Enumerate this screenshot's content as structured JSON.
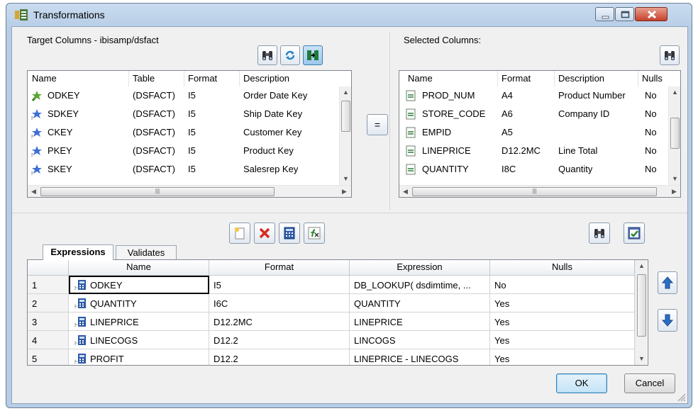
{
  "window": {
    "title": "Transformations"
  },
  "target": {
    "label": "Target Columns - ibisamp/dsfact",
    "headers": [
      "Name",
      "Table",
      "Format",
      "Description"
    ],
    "rows": [
      {
        "name": "ODKEY",
        "table": "(DSFACT)",
        "format": "I5",
        "description": "Order Date Key",
        "icon": "key-green-icon"
      },
      {
        "name": "SDKEY",
        "table": "(DSFACT)",
        "format": "I5",
        "description": "Ship Date Key",
        "icon": "key-blue-icon"
      },
      {
        "name": "CKEY",
        "table": "(DSFACT)",
        "format": "I5",
        "description": "Customer Key",
        "icon": "key-blue-icon"
      },
      {
        "name": "PKEY",
        "table": "(DSFACT)",
        "format": "I5",
        "description": "Product Key",
        "icon": "key-blue-icon"
      },
      {
        "name": "SKEY",
        "table": "(DSFACT)",
        "format": "I5",
        "description": "Salesrep Key",
        "icon": "key-blue-icon"
      }
    ]
  },
  "selected": {
    "label": "Selected Columns:",
    "headers": [
      "Name",
      "Format",
      "Description",
      "Nulls"
    ],
    "rows": [
      {
        "name": "PROD_NUM",
        "format": "A4",
        "description": "Product Number",
        "nulls": "No"
      },
      {
        "name": "STORE_CODE",
        "format": "A6",
        "description": "Company ID",
        "nulls": "No"
      },
      {
        "name": "EMPID",
        "format": "A5",
        "description": "",
        "nulls": "No"
      },
      {
        "name": "LINEPRICE",
        "format": "D12.2MC",
        "description": "Line Total",
        "nulls": "No"
      },
      {
        "name": "QUANTITY",
        "format": "I8C",
        "description": "Quantity",
        "nulls": "No"
      }
    ]
  },
  "equal_button": "=",
  "tabs": [
    "Expressions",
    "Validates"
  ],
  "expressions": {
    "headers": [
      "Name",
      "Format",
      "Expression",
      "Nulls"
    ],
    "rows": [
      {
        "num": "1",
        "name": "ODKEY",
        "format": "I5",
        "expression": "DB_LOOKUP( dsdimtime, ...",
        "nulls": "No"
      },
      {
        "num": "2",
        "name": "QUANTITY",
        "format": "I6C",
        "expression": "QUANTITY",
        "nulls": "Yes"
      },
      {
        "num": "3",
        "name": "LINEPRICE",
        "format": "D12.2MC",
        "expression": "LINEPRICE",
        "nulls": "Yes"
      },
      {
        "num": "4",
        "name": "LINECOGS",
        "format": "D12.2",
        "expression": "LINCOGS",
        "nulls": "Yes"
      },
      {
        "num": "5",
        "name": "PROFIT",
        "format": "D12.2",
        "expression": "LINEPRICE - LINECOGS",
        "nulls": "Yes"
      }
    ]
  },
  "buttons": {
    "ok": "OK",
    "cancel": "Cancel"
  },
  "colors": {
    "accent": "#3c7fb1",
    "close": "#c7402b"
  }
}
